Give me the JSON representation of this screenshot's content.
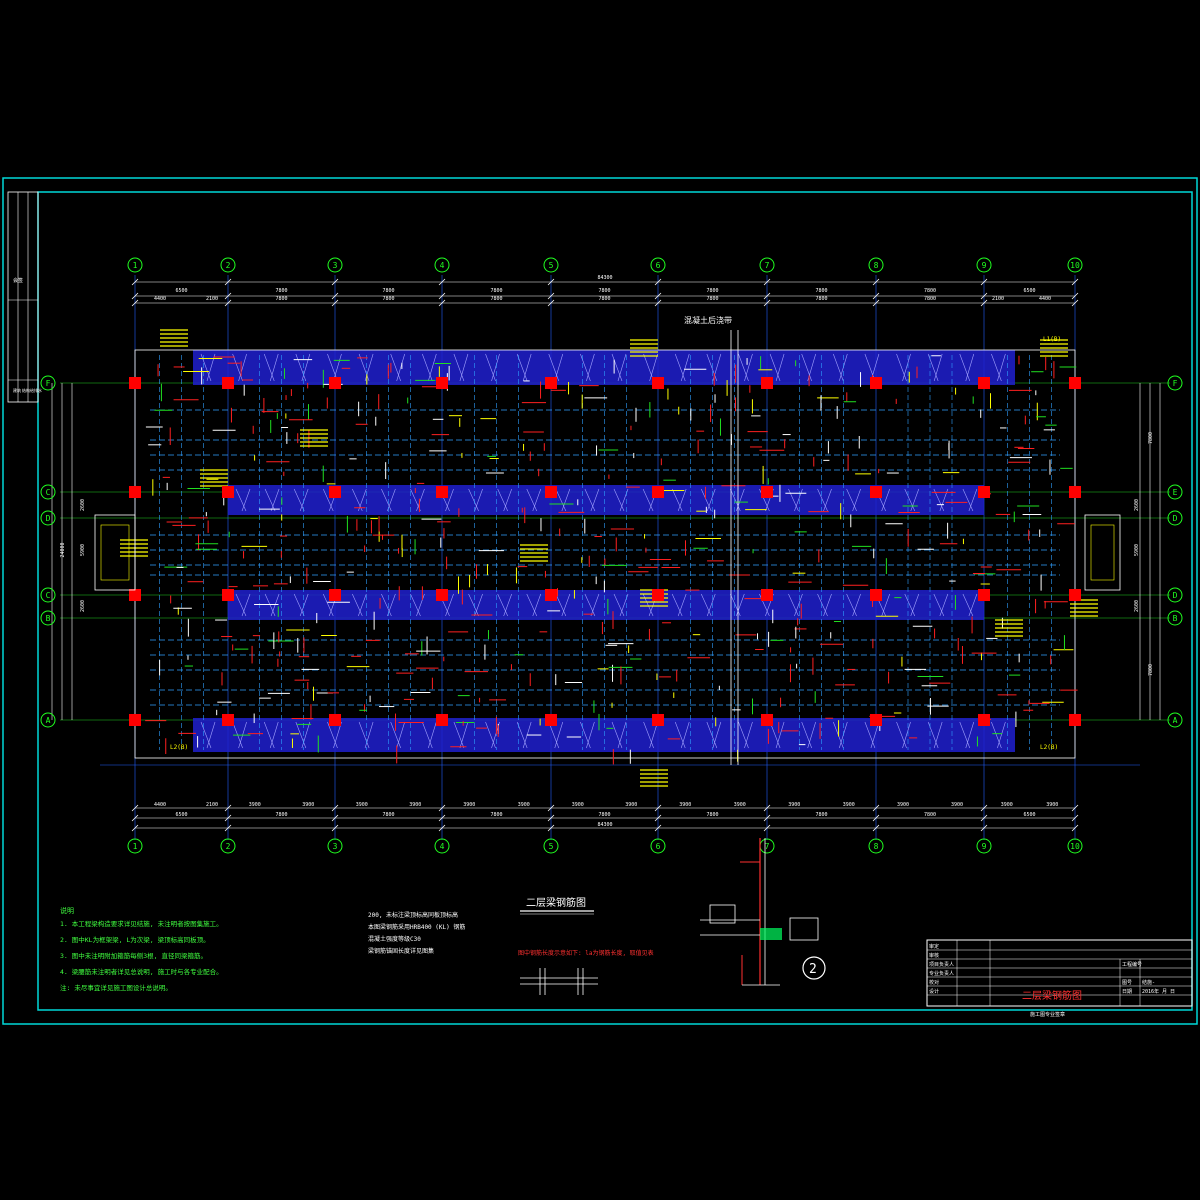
{
  "grid": {
    "columns": [
      "1",
      "2",
      "3",
      "4",
      "5",
      "6",
      "7",
      "8",
      "9",
      "10"
    ],
    "rows_left": [
      "F",
      "C",
      "D",
      "C",
      "B",
      "A"
    ],
    "rows_right": [
      "F",
      "E",
      "D",
      "D",
      "B",
      "A"
    ]
  },
  "dimensions": {
    "top_overall": "84300",
    "top_row1": [
      "4400",
      "2100",
      "7800",
      "7800",
      "7800",
      "7800",
      "7800",
      "7800",
      "7800",
      "2100",
      "4400"
    ],
    "top_row2": [
      "6500",
      "7800",
      "7800",
      "7800",
      "7800",
      "7800",
      "7800",
      "7800",
      "6500"
    ],
    "bottom_row1": [
      "4400",
      "2100",
      "3900",
      "3900",
      "3900",
      "3900",
      "3900",
      "3900",
      "3900",
      "3900",
      "3900",
      "3900",
      "3900",
      "3900"
    ],
    "bottom_row2": [
      "6500",
      "7800",
      "7800",
      "7800",
      "7800",
      "7800",
      "7800",
      "7800",
      "6500"
    ],
    "bottom_overall": "84300",
    "left_vertical": [
      "24000",
      "2600",
      "5900",
      "2600"
    ],
    "right_vertical": [
      "7800",
      "2600",
      "5900",
      "2600",
      "7800"
    ]
  },
  "labels": {
    "expansion_joint": "混凝土后浇带",
    "plan_title": "二层梁钢筋图",
    "legend_note": "图中钢筋长度示意如下: la为钢筋长度, 取值见表",
    "section_mark": "2",
    "beam_tag": "L1(B)",
    "beam_tag_2": "L2(B)"
  },
  "notes": {
    "heading": "说明",
    "lines": [
      "1. 本工程梁构造要求详见结施, 未注明者按图集施工。",
      "2. 图中KL为框架梁, L为次梁, 梁顶标高同板顶。",
      "3. 图中未注明附加箍筋每侧3根, 直径同梁箍筋。",
      "4. 梁腰筋未注明者详见总说明, 施工时与各专业配合。",
      "注: 未尽事宜详见施工图设计总说明。"
    ],
    "col2": [
      "200, 未标注梁顶标高同板顶标高",
      "本图梁钢筋采用HRB400 (KL) 钢筋",
      "混凝土强度等级C30",
      "梁钢筋锚固长度详见图集"
    ]
  },
  "title_block": {
    "drawing_title": "二层梁钢筋图",
    "footer": "施工图专业签章",
    "rows": [
      "审定",
      "审核",
      "项目负责人",
      "专业负责人",
      "校对",
      "设计"
    ],
    "right_labels": [
      "工程编号",
      "图号",
      "日期"
    ],
    "right_values": [
      "",
      "结施-",
      "2016年 月 日"
    ]
  },
  "side_strip": {
    "labels": [
      "会签",
      "建筑",
      "结构",
      "给排水"
    ]
  },
  "colors": {
    "frame": "#00d8d8",
    "grid_line": "#20d020",
    "beam_fill": "#2020d0",
    "column": "#ff0000",
    "rebar": "#ff2020",
    "text_yellow": "#ffff00",
    "text_white": "#ffffff",
    "text_green": "#40ff40",
    "axis_bubble": "#20ff20"
  }
}
